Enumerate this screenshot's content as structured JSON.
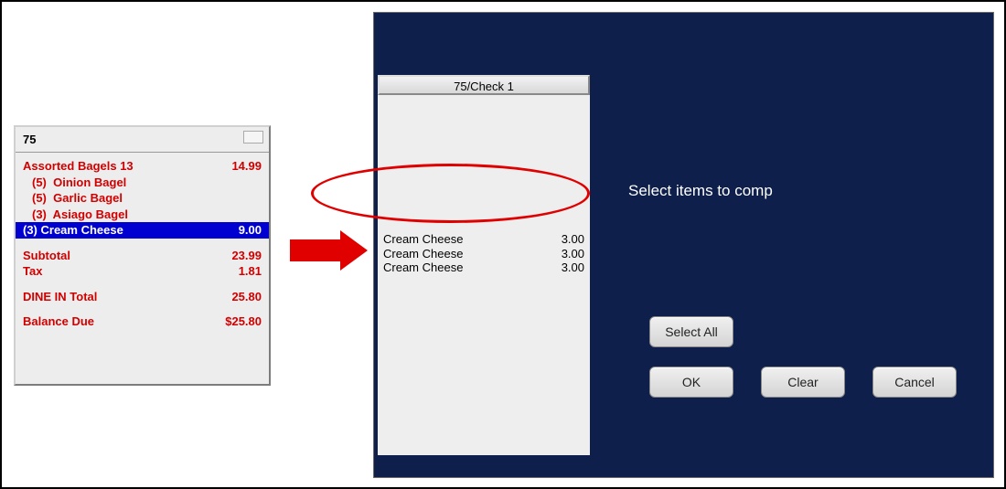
{
  "receipt": {
    "header_num": "75",
    "items": [
      {
        "name": "Assorted Bagels 13",
        "price": "14.99",
        "mod": false
      },
      {
        "name": "(5)  Oinion Bagel",
        "price": "",
        "mod": true
      },
      {
        "name": "(5)  Garlic Bagel",
        "price": "",
        "mod": true
      },
      {
        "name": "(3)  Asiago Bagel",
        "price": "",
        "mod": true
      }
    ],
    "highlight": {
      "name": "(3) Cream Cheese",
      "price": "9.00"
    },
    "subtotal_label": "Subtotal",
    "subtotal": "23.99",
    "tax_label": "Tax",
    "tax": "1.81",
    "total_label": "DINE IN Total",
    "total": "25.80",
    "balance_label": "Balance Due",
    "balance": "$25.80"
  },
  "comp": {
    "check_title": "75/Check 1",
    "lines": [
      {
        "name": "Cream Cheese",
        "price": "3.00"
      },
      {
        "name": "Cream Cheese",
        "price": "3.00"
      },
      {
        "name": "Cream Cheese",
        "price": "3.00"
      }
    ],
    "prompt": "Select items to comp",
    "btn_select_all": "Select All",
    "btn_ok": "OK",
    "btn_clear": "Clear",
    "btn_cancel": "Cancel"
  }
}
